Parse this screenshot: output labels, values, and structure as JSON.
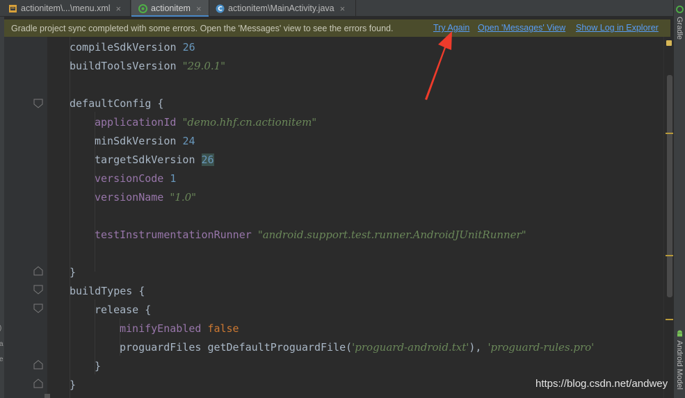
{
  "tabs": [
    {
      "label": "actionitem\\...\\menu.xml",
      "icon": "xml-file-icon"
    },
    {
      "label": "actionitem",
      "icon": "gradle-file-icon"
    },
    {
      "label": "actionitem\\MainActivity.java",
      "icon": "java-class-icon"
    }
  ],
  "tab_close_glyph": "×",
  "banner": {
    "message": "Gradle project sync completed with some errors. Open the 'Messages' view to see the errors found.",
    "links": [
      "Try Again",
      "Open 'Messages' View",
      "Show Log in Explorer"
    ]
  },
  "code": {
    "compileSdkVersion": {
      "key": "compileSdkVersion",
      "value": "26"
    },
    "buildToolsVersion": {
      "key": "buildToolsVersion",
      "value": "\"29.0.1\""
    },
    "defaultConfig_open": "defaultConfig {",
    "applicationId": {
      "key": "applicationId",
      "value": "\"demo.hhf.cn.actionitem\""
    },
    "minSdkVersion": {
      "key": "minSdkVersion",
      "value": "24"
    },
    "targetSdkVersion": {
      "key": "targetSdkVersion",
      "value": "26"
    },
    "versionCode": {
      "key": "versionCode",
      "value": "1"
    },
    "versionName": {
      "key": "versionName",
      "value": "\"1.0\""
    },
    "testRunner": {
      "key": "testInstrumentationRunner",
      "value": "\"android.support.test.runner.AndroidJUnitRunner\""
    },
    "close_brace": "}",
    "buildTypes_open": "buildTypes {",
    "release_open": "release {",
    "minifyEnabled": {
      "key": "minifyEnabled",
      "value": "false"
    },
    "proguard": {
      "key": "proguardFiles",
      "fn": "getDefaultProguardFile(",
      "arg1": "'proguard-android.txt'",
      "sep": "), ",
      "arg2": "'proguard-rules.pro'"
    }
  },
  "right_tool_windows": [
    "Gradle",
    "Android Model"
  ],
  "watermark": "https://blog.csdn.net/andwey",
  "colors": {
    "keyword": "#cc7832",
    "number": "#6897bb",
    "string": "#6a8759",
    "property": "#9876aa",
    "link": "#589df6",
    "banner_bg": "#4b4c2c",
    "annotation_arrow": "#ee3b2b"
  }
}
